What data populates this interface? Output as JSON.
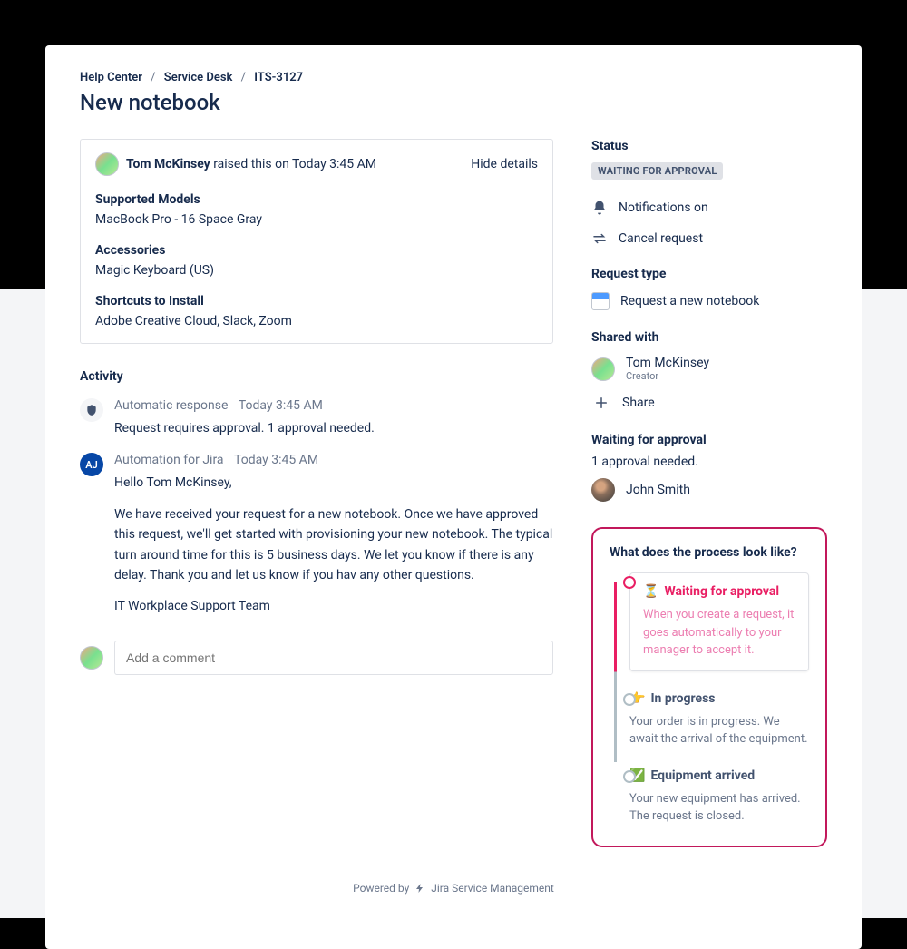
{
  "breadcrumb": {
    "help_center": "Help Center",
    "service_desk": "Service Desk",
    "issue_key": "ITS-3127"
  },
  "page_title": "New notebook",
  "raised": {
    "reporter": "Tom McKinsey",
    "text_suffix": " raised this on Today 3:45 AM",
    "hide_details": "Hide details"
  },
  "fields": {
    "supported_label": "Supported Models",
    "supported_value": "MacBook Pro - 16 Space Gray",
    "accessories_label": "Accessories",
    "accessories_value": "Magic Keyboard (US)",
    "shortcuts_label": "Shortcuts to Install",
    "shortcuts_value": "Adobe Creative Cloud, Slack, Zoom"
  },
  "activity": {
    "heading": "Activity",
    "items": [
      {
        "avatar_kind": "bot",
        "author": "Automatic response",
        "date": "Today 3:45 AM",
        "body1": "Request requires approval. 1 approval needed."
      },
      {
        "avatar_kind": "aj",
        "author": "Automation for Jira",
        "date": "Today 3:45 AM",
        "body1": "Hello Tom McKinsey,",
        "body2": "We have received your request for a new notebook. Once we have approved this request, we'll get started with provisioning your new notebook.  The typical turn around time for this is 5 business days. We let you know if there is any delay. Thank you and let us know if you hav any other questions.",
        "body3": "IT Workplace Support Team"
      }
    ],
    "comment_placeholder": "Add a comment"
  },
  "sidebar": {
    "status_label": "Status",
    "status_value": "WAITING FOR APPROVAL",
    "notifications": "Notifications on",
    "cancel": "Cancel request",
    "request_type_label": "Request type",
    "request_type_value": "Request a new notebook",
    "shared_with_label": "Shared with",
    "shared_name": "Tom McKinsey",
    "shared_role": "Creator",
    "share_btn": "Share",
    "approval_label": "Waiting for approval",
    "approval_line": "1 approval needed.",
    "approver": "John Smith"
  },
  "callout": {
    "title": "What does the process look like?",
    "s1_title": "Waiting for approval",
    "s1_desc": "When you create a request, it goes automatically to your manager to accept it.",
    "s2_title": "In progress",
    "s2_desc": "Your order is in progress. We await the arrival of the equipment.",
    "s3_title": "Equipment arrived",
    "s3_desc": "Your new equipment has arrived. The request is closed."
  },
  "footer": {
    "powered_by": "Powered by",
    "product": "Jira Service Management"
  }
}
